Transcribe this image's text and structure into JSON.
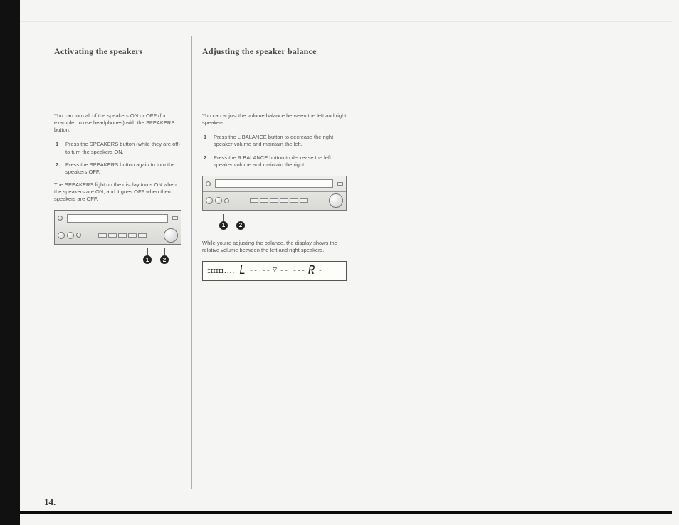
{
  "page_number": "14.",
  "left": {
    "title": "Activating the speakers",
    "intro": "You can turn all of the speakers ON or OFF (for example, to use headphones) with the SPEAKERS button.",
    "steps": [
      {
        "num": "1",
        "text": "Press the SPEAKERS button (while they are off) to turn the speakers ON."
      },
      {
        "num": "2",
        "text": "Press the SPEAKERS button again to turn the speakers OFF."
      }
    ],
    "note": "The SPEAKERS light on the display turns ON when the speakers are ON, and it goes OFF when then speakers are OFF.",
    "callouts": [
      "1",
      "2"
    ]
  },
  "right": {
    "title": "Adjusting the speaker balance",
    "intro": "You can adjust the volume balance between the left and right speakers.",
    "steps": [
      {
        "num": "1",
        "text": "Press the L BALANCE button to decrease the right speaker volume and maintain the left."
      },
      {
        "num": "2",
        "text": "Press the R BALANCE button to decrease the left speaker volume and maintain the right."
      }
    ],
    "callouts": [
      "1",
      "2"
    ],
    "post_note": "While you're adjusting the balance, the display shows the relative volume between the left and right speakers.",
    "lcd": {
      "bars": "IIIIII....",
      "left_char": "L",
      "dashes_left": "-- --",
      "center_marker": "▽",
      "dashes_right": "-- ---",
      "right_char": "R",
      "trail": "-"
    }
  }
}
